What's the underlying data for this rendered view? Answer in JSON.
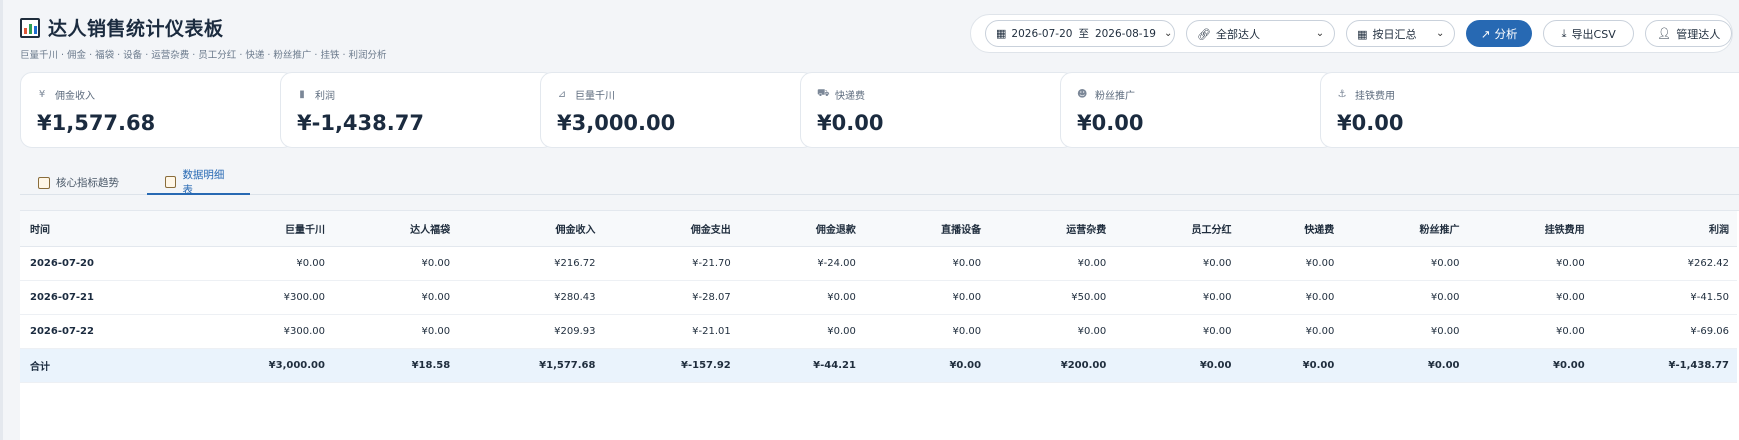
{
  "header": {
    "title": "达人销售统计仪表板",
    "subtitle": "巨量千川 · 佣金 · 福袋 · 设备 · 运营杂费 · 员工分红 · 快递 · 粉丝推广 · 挂铁 · 利润分析"
  },
  "toolbar": {
    "date_start": "2026-07-20",
    "date_sep": "至",
    "date_end": "2026-08-19",
    "user_select": "全部达人",
    "group_select": "按日汇总",
    "analyze_label": "分析",
    "export_label": "导出CSV",
    "manage_label": "管理达人"
  },
  "cards": [
    {
      "label": "佣金收入",
      "value": "¥1,577.68",
      "icon": "yen-icon"
    },
    {
      "label": "利润",
      "value": "¥-1,438.77",
      "icon": "bar-chart-icon"
    },
    {
      "label": "巨量千川",
      "value": "¥3,000.00",
      "icon": "area-chart-icon"
    },
    {
      "label": "快递费",
      "value": "¥0.00",
      "icon": "truck-icon"
    },
    {
      "label": "粉丝推广",
      "value": "¥0.00",
      "icon": "users-icon"
    },
    {
      "label": "挂铁费用",
      "value": "¥0.00",
      "icon": "anchor-icon"
    }
  ],
  "tabs": [
    {
      "label": "核心指标趋势"
    },
    {
      "label": "数据明细表"
    }
  ],
  "table": {
    "columns": [
      "时间",
      "巨量千川",
      "达人福袋",
      "佣金收入",
      "佣金支出",
      "佣金退款",
      "直播设备",
      "运营杂费",
      "员工分红",
      "快递费",
      "粉丝推广",
      "挂铁费用",
      "利润"
    ],
    "rows": [
      [
        "2026-07-20",
        "¥0.00",
        "¥0.00",
        "¥216.72",
        "¥-21.70",
        "¥-24.00",
        "¥0.00",
        "¥0.00",
        "¥0.00",
        "¥0.00",
        "¥0.00",
        "¥0.00",
        "¥262.42"
      ],
      [
        "2026-07-21",
        "¥300.00",
        "¥0.00",
        "¥280.43",
        "¥-28.07",
        "¥0.00",
        "¥0.00",
        "¥50.00",
        "¥0.00",
        "¥0.00",
        "¥0.00",
        "¥0.00",
        "¥-41.50"
      ],
      [
        "2026-07-22",
        "¥300.00",
        "¥0.00",
        "¥209.93",
        "¥-21.01",
        "¥0.00",
        "¥0.00",
        "¥0.00",
        "¥0.00",
        "¥0.00",
        "¥0.00",
        "¥0.00",
        "¥-69.06"
      ]
    ],
    "total": [
      "合计",
      "¥3,000.00",
      "¥18.58",
      "¥1,577.68",
      "¥-157.92",
      "¥-44.21",
      "¥0.00",
      "¥200.00",
      "¥0.00",
      "¥0.00",
      "¥0.00",
      "¥0.00",
      "¥-1,438.77"
    ]
  }
}
